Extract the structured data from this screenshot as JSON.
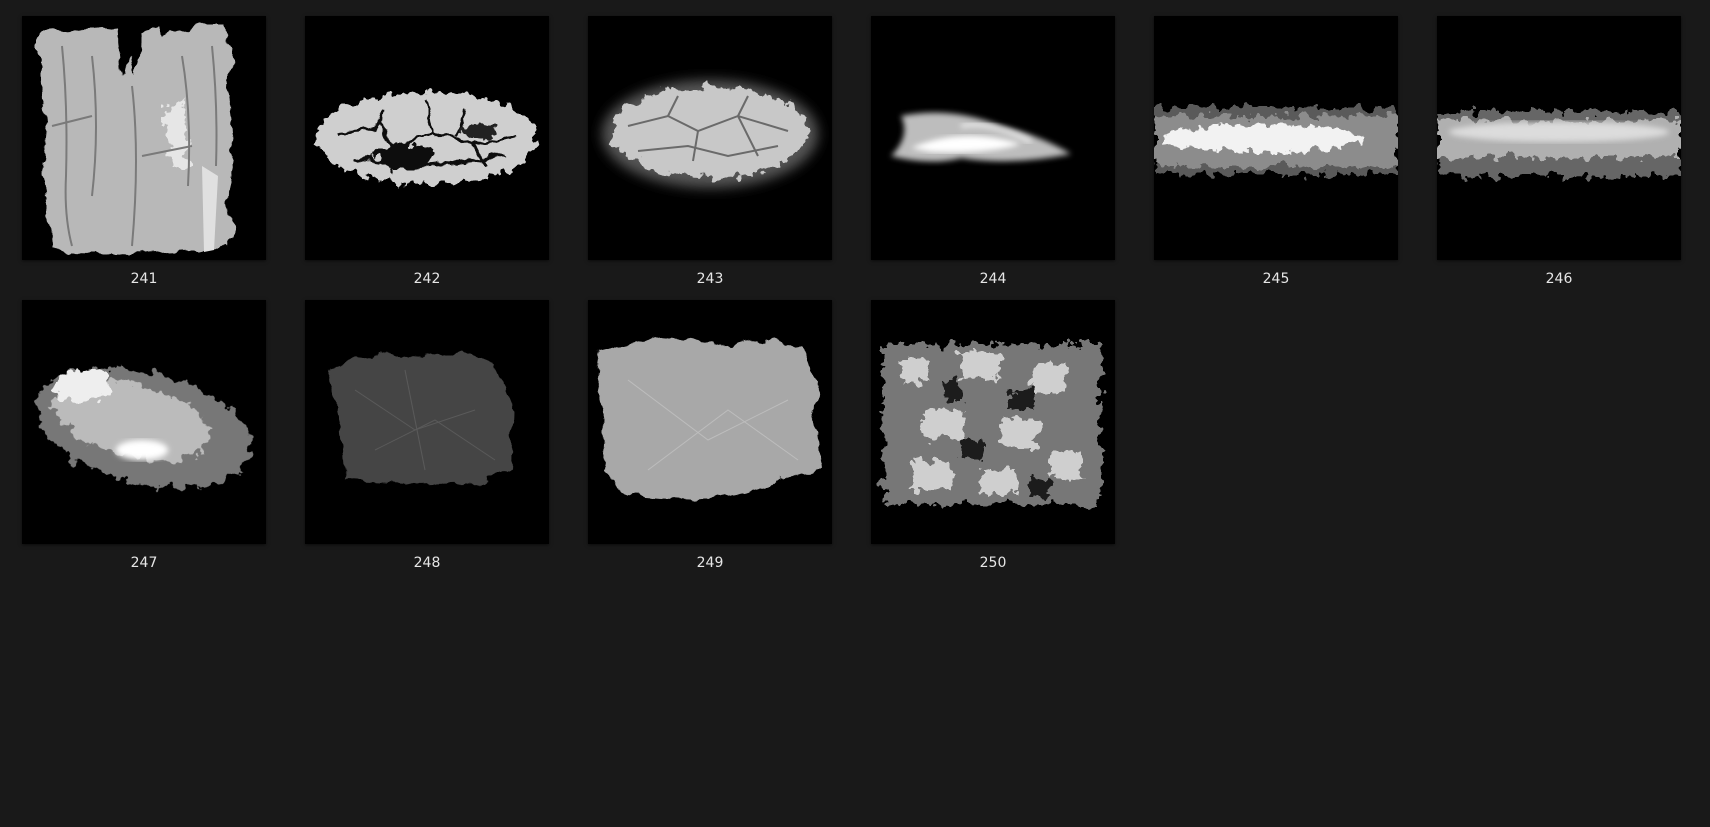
{
  "gallery": {
    "items": [
      {
        "label": "241",
        "texture": "torn-bark-texture"
      },
      {
        "label": "242",
        "texture": "cracked-mud-texture"
      },
      {
        "label": "243",
        "texture": "cracked-earth-texture"
      },
      {
        "label": "244",
        "texture": "smoke-streak-texture"
      },
      {
        "label": "245",
        "texture": "grunge-strip-texture"
      },
      {
        "label": "246",
        "texture": "foam-strip-texture"
      },
      {
        "label": "247",
        "texture": "cloud-burst-texture"
      },
      {
        "label": "248",
        "texture": "dark-paper-texture"
      },
      {
        "label": "249",
        "texture": "light-paper-texture"
      },
      {
        "label": "250",
        "texture": "crumpled-foil-texture"
      }
    ]
  }
}
